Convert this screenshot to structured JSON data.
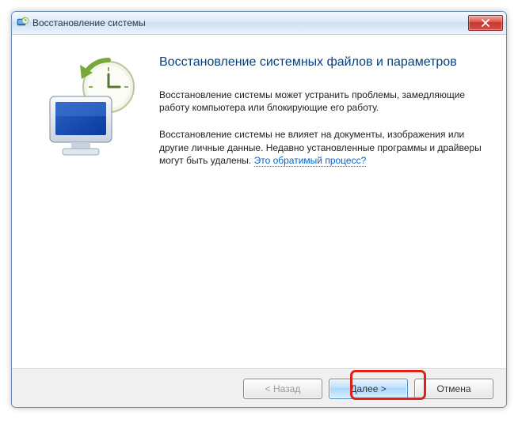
{
  "window": {
    "title": "Восстановление системы"
  },
  "page": {
    "heading": "Восстановление системных файлов и параметров",
    "paragraph1": "Восстановление системы может устранить проблемы, замедляющие работу компьютера или блокирующие его работу.",
    "paragraph2_prefix": "Восстановление системы не влияет на документы, изображения или другие личные данные. Недавно установленные программы и драйверы могут быть удалены. ",
    "link_text": "Это обратимый процесс?"
  },
  "buttons": {
    "back": "< Назад",
    "next": "Далее >",
    "cancel": "Отмена"
  },
  "icons": {
    "title": "system-restore-icon",
    "close": "close-icon",
    "graphic": "restore-monitor-clock-icon"
  }
}
